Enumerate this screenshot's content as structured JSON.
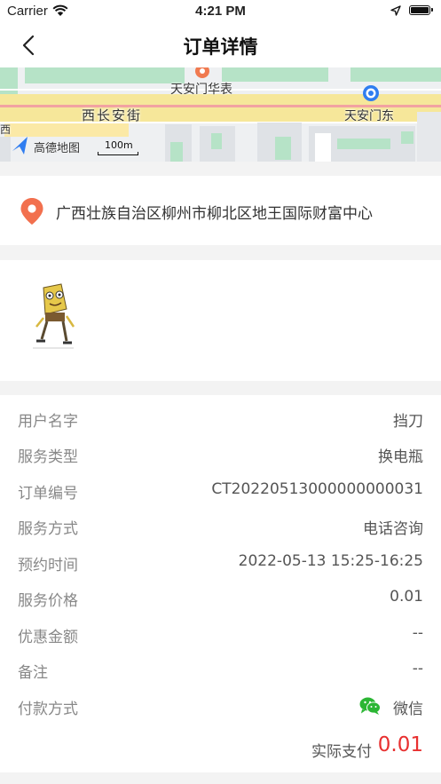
{
  "status_bar": {
    "carrier": "Carrier",
    "time": "4:21 PM"
  },
  "nav": {
    "title": "订单详情"
  },
  "map": {
    "labels": {
      "tiananmen_huabiao": "天安门华表",
      "xichanganjie": "西长安街",
      "tiananmen_east": "天安门东",
      "edge_xi": "西"
    },
    "logo_text": "高德地图",
    "scale_text": "100m"
  },
  "address": {
    "text": "广西壮族自治区柳州市柳北区地王国际财富中心"
  },
  "details": {
    "rows": [
      {
        "label": "用户名字",
        "value": "挡刀"
      },
      {
        "label": "服务类型",
        "value": "换电瓶"
      },
      {
        "label": "订单编号",
        "value": "CT20220513000000000031"
      },
      {
        "label": "服务方式",
        "value": "电话咨询"
      },
      {
        "label": "预约时间",
        "value": "2022-05-13 15:25-16:25"
      },
      {
        "label": "服务价格",
        "value": "0.01"
      },
      {
        "label": "优惠金额",
        "value": "--"
      },
      {
        "label": "备注",
        "value": "--"
      },
      {
        "label": "付款方式",
        "value": "微信"
      }
    ],
    "total_label": "实际支付",
    "total_value": "0.01"
  },
  "colors": {
    "accent_red": "#e83030",
    "wechat_green": "#2bb634",
    "pin_orange": "#f2704e"
  }
}
